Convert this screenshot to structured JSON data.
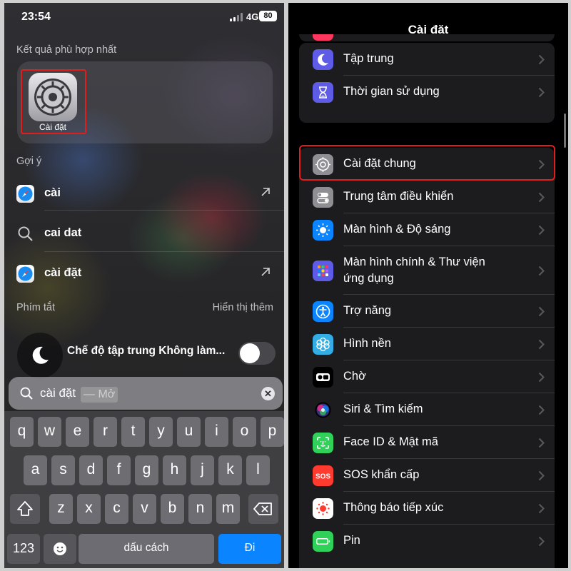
{
  "left": {
    "status": {
      "time": "23:54",
      "network": "4G",
      "battery": "80"
    },
    "best_match": {
      "heading": "Kết quả phù hợp nhất",
      "app_name": "Cài đặt"
    },
    "suggestions": {
      "heading": "Gợi ý",
      "items": [
        {
          "icon": "safari-icon",
          "text": "cài"
        },
        {
          "icon": "search-icon",
          "text": "cai dat"
        },
        {
          "icon": "safari-icon",
          "text": "cài đặt"
        }
      ]
    },
    "shortcuts": {
      "heading": "Phím tắt",
      "more": "Hiển thị thêm",
      "focus_label": "Chế độ tập trung Không làm...",
      "focus_on": false
    },
    "search": {
      "query": "cài đặt",
      "suffix": "— Mở"
    },
    "keyboard": {
      "row1": [
        "q",
        "w",
        "e",
        "r",
        "t",
        "y",
        "u",
        "i",
        "o",
        "p"
      ],
      "row2": [
        "a",
        "s",
        "d",
        "f",
        "g",
        "h",
        "j",
        "k",
        "l"
      ],
      "row3": [
        "z",
        "x",
        "c",
        "v",
        "b",
        "n",
        "m"
      ],
      "numbers": "123",
      "space": "dấu cách",
      "go": "Đi"
    }
  },
  "right": {
    "title": "Cài đặt",
    "group1": [
      {
        "label": "Tập trung",
        "icon": "moon-icon",
        "color": "#5e5ce6"
      },
      {
        "label": "Thời gian sử dụng",
        "icon": "hourglass-icon",
        "color": "#5e5ce6"
      }
    ],
    "group2": [
      {
        "label": "Cài đặt chung",
        "icon": "gear-icon",
        "color": "#8e8e93"
      },
      {
        "label": "Trung tâm điều khiển",
        "icon": "toggles-icon",
        "color": "#8e8e93"
      },
      {
        "label": "Màn hình & Độ sáng",
        "icon": "sun-icon",
        "color": "#0a84ff"
      },
      {
        "label": "Màn hình chính & Thư viện",
        "label_line2": "ứng dụng",
        "icon": "app-grid-icon",
        "color": "#5e5ce6"
      },
      {
        "label": "Trợ năng",
        "icon": "accessibility-icon",
        "color": "#0a84ff"
      },
      {
        "label": "Hình nền",
        "icon": "flower-icon",
        "color": "#32ade6"
      },
      {
        "label": "Chờ",
        "icon": "standby-icon",
        "color": "#000000"
      },
      {
        "label": "Siri & Tìm kiếm",
        "icon": "siri-icon",
        "color": "#1c1c1e"
      },
      {
        "label": "Face ID & Mật mã",
        "icon": "face-id-icon",
        "color": "#30d158"
      },
      {
        "label": "SOS khẩn cấp",
        "icon": "sos-icon",
        "color": "#ff3b30"
      },
      {
        "label": "Thông báo tiếp xúc",
        "icon": "exposure-icon",
        "color": "#ffffff"
      },
      {
        "label": "Pin",
        "icon": "battery-icon",
        "color": "#30d158"
      }
    ]
  }
}
